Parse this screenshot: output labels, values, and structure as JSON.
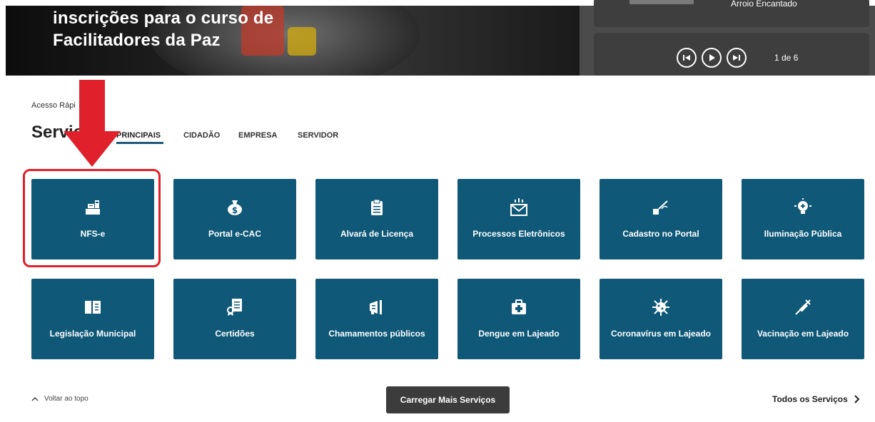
{
  "hero": {
    "title_line1": "inscrições para o curso de",
    "title_line2": "Facilitadores da Paz"
  },
  "news": {
    "caption": "Arroio Encantado",
    "counter": "1 de 6",
    "controls": {
      "prev_icon": "skip-previous-icon",
      "play_icon": "play-icon",
      "next_icon": "skip-next-icon"
    }
  },
  "services": {
    "quick_access": "Acesso Rápi",
    "title": "Serviç",
    "tabs": [
      "PRINCIPAIS",
      "CIDADÃO",
      "EMPRESA",
      "SERVIDOR"
    ],
    "active_tab": "PRINCIPAIS",
    "cards": [
      {
        "label": "NFS-e",
        "icon": "cash-register-icon"
      },
      {
        "label": "Portal e-CAC",
        "icon": "money-bag-icon"
      },
      {
        "label": "Alvará de Licença",
        "icon": "clipboard-icon"
      },
      {
        "label": "Processos Eletrônicos",
        "icon": "envelope-icon"
      },
      {
        "label": "Cadastro no Portal",
        "icon": "signature-icon"
      },
      {
        "label": "Iluminação Pública",
        "icon": "lightbulb-icon"
      },
      {
        "label": "Legislação Municipal",
        "icon": "book-icon"
      },
      {
        "label": "Certidões",
        "icon": "certificate-icon"
      },
      {
        "label": "Chamamentos públicos",
        "icon": "megaphone-icon"
      },
      {
        "label": "Dengue em Lajeado",
        "icon": "medkit-icon"
      },
      {
        "label": "Coronavírus em Lajeado",
        "icon": "virus-icon"
      },
      {
        "label": "Vacinação em Lajeado",
        "icon": "syringe-icon"
      }
    ]
  },
  "footer": {
    "back_to_top": "Voltar ao topo",
    "load_more": "Carregar Mais Serviços",
    "all_services": "Todos os Serviços"
  },
  "colors": {
    "card_bg": "#0f5878",
    "annotation_red": "#e0202b",
    "tab_underline": "#1d5a78",
    "load_more_bg": "#3c3c3c"
  }
}
